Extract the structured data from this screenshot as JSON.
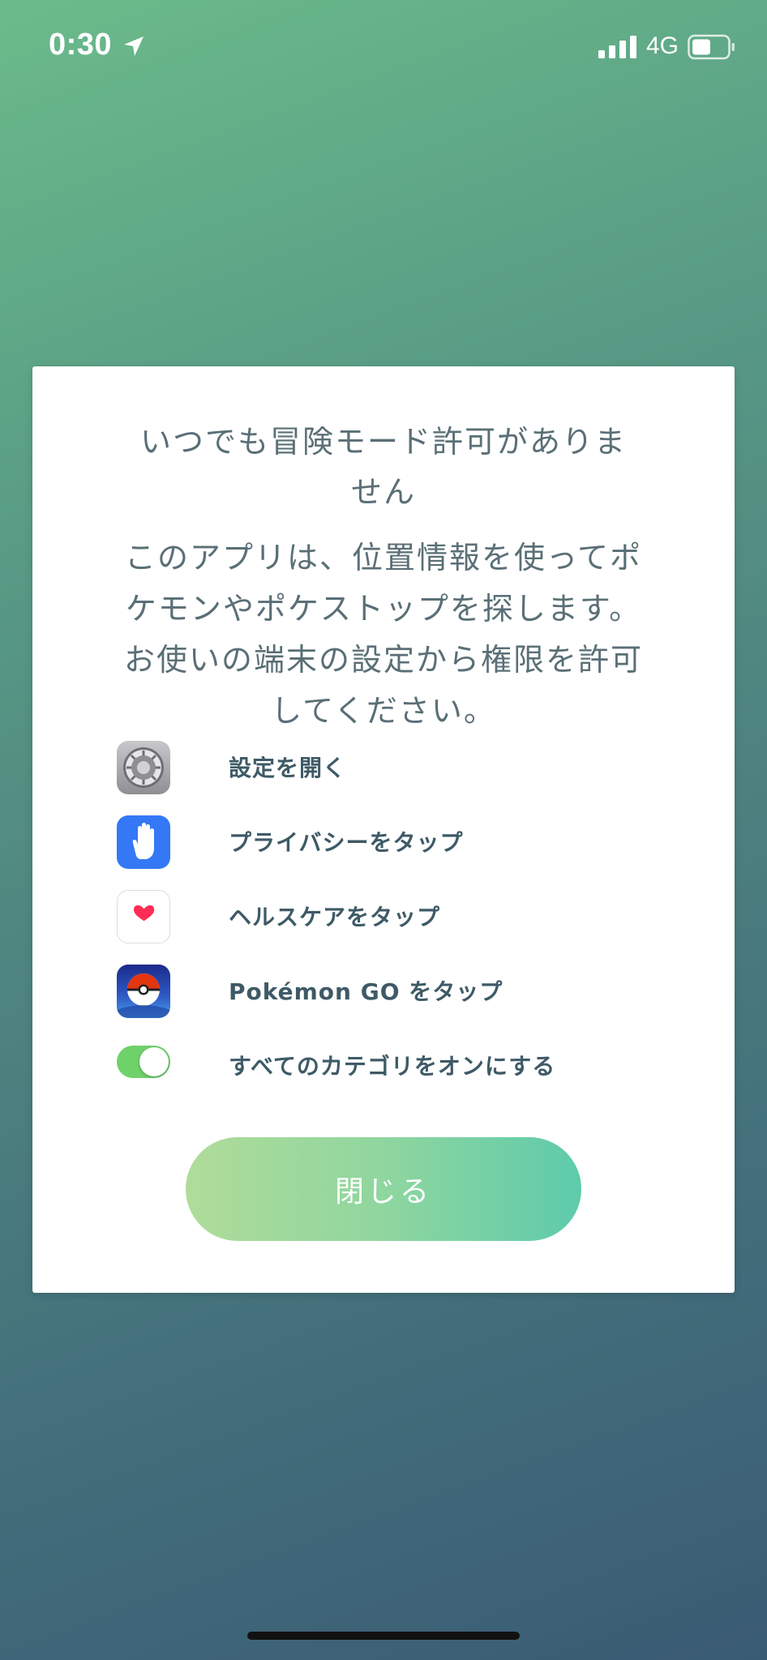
{
  "status_bar": {
    "time": "0:30",
    "network": "4G",
    "icons": [
      "location-arrow-icon",
      "signal-icon",
      "battery-icon"
    ]
  },
  "dialog": {
    "title": "いつでも冒険モード許可がありません",
    "message": "このアプリは、位置情報を使ってポケモンやポケストップを探します。お使いの端末の設定から権限を許可してください。",
    "steps": [
      {
        "icon": "settings-app-icon",
        "label": "設定を開く"
      },
      {
        "icon": "privacy-hand-icon",
        "label": "プライバシーをタップ"
      },
      {
        "icon": "health-heart-icon",
        "label": "ヘルスケアをタップ"
      },
      {
        "icon": "pokemon-go-app-icon",
        "label": "Pokémon GO をタップ"
      },
      {
        "icon": "toggle-on-icon",
        "label": "すべてのカテゴリをオンにする"
      }
    ],
    "close_label": "閉じる"
  },
  "colors": {
    "text": "#5a6f76",
    "step_text": "#3e5a66",
    "toggle_on": "#6fd16a",
    "button_start": "#b0dc9a",
    "button_end": "#5ecbab"
  }
}
